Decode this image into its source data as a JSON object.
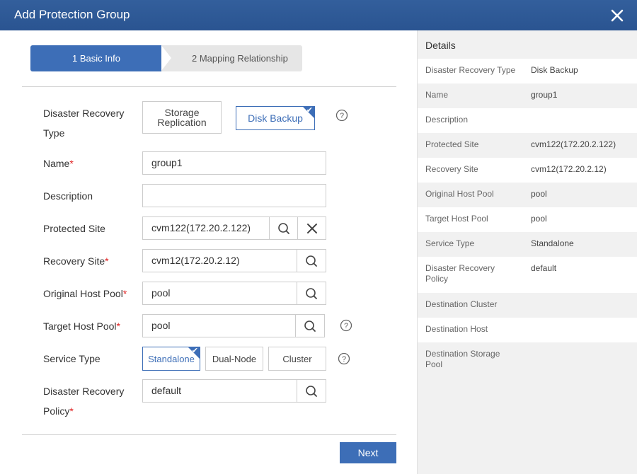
{
  "dialog": {
    "title": "Add Protection Group"
  },
  "steps": [
    {
      "label": "1 Basic Info"
    },
    {
      "label": "2 Mapping Relationship"
    }
  ],
  "form": {
    "dr_type": {
      "label": "Disaster Recovery Type",
      "options": [
        "Storage Replication",
        "Disk Backup"
      ],
      "selected": "Disk Backup"
    },
    "name": {
      "label": "Name",
      "value": "group1"
    },
    "description": {
      "label": "Description",
      "value": ""
    },
    "protected_site": {
      "label": "Protected Site",
      "value": "cvm122(172.20.2.122)"
    },
    "recovery_site": {
      "label": "Recovery Site",
      "value": "cvm12(172.20.2.12)"
    },
    "original_host_pool": {
      "label": "Original Host Pool",
      "value": "pool"
    },
    "target_host_pool": {
      "label": "Target Host Pool",
      "value": "pool"
    },
    "service_type": {
      "label": "Service Type",
      "options": [
        "Standalone",
        "Dual-Node",
        "Cluster"
      ],
      "selected": "Standalone"
    },
    "dr_policy": {
      "label": "Disaster Recovery Policy",
      "value": "default"
    },
    "required_mark": "*",
    "next_label": "Next"
  },
  "details": {
    "title": "Details",
    "rows": [
      {
        "key": "Disaster Recovery Type",
        "value": "Disk Backup"
      },
      {
        "key": "Name",
        "value": "group1"
      },
      {
        "key": "Description",
        "value": ""
      },
      {
        "key": "Protected Site",
        "value": "cvm122(172.20.2.122)"
      },
      {
        "key": "Recovery Site",
        "value": "cvm12(172.20.2.12)"
      },
      {
        "key": "Original Host Pool",
        "value": "pool"
      },
      {
        "key": "Target Host Pool",
        "value": "pool"
      },
      {
        "key": "Service Type",
        "value": "Standalone"
      },
      {
        "key": "Disaster Recovery Policy",
        "value": "default"
      },
      {
        "key": "Destination Cluster",
        "value": ""
      },
      {
        "key": "Destination Host",
        "value": ""
      },
      {
        "key": "Destination Storage Pool",
        "value": ""
      }
    ]
  },
  "colors": {
    "accent": "#3d6eb7",
    "header": "#2f5a97",
    "required": "#e02020"
  }
}
